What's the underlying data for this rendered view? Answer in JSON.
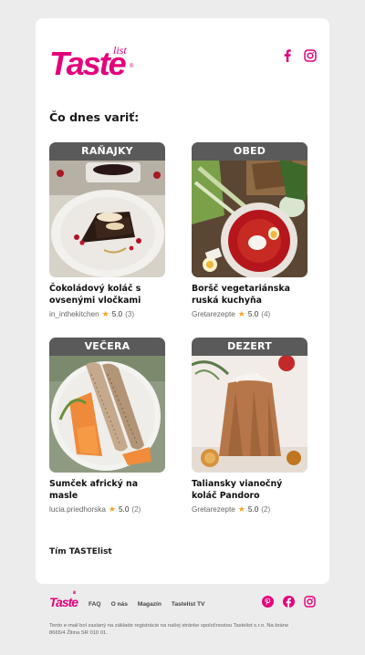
{
  "brand": {
    "logo_text": "Taste",
    "logo_sub": "list",
    "color": "#e4007c"
  },
  "social_top": [
    {
      "icon": "facebook-icon"
    },
    {
      "icon": "instagram-icon"
    }
  ],
  "heading": "Čo dnes variť:",
  "recipes": [
    {
      "category": "RAŇAJKY",
      "title": "Čokoládový koláč s ovsenými vločkami",
      "author": "in_inthekitchen",
      "rating": "5.0",
      "count": "(3)"
    },
    {
      "category": "OBED",
      "title": "Boršč vegetariánska ruská kuchyňa",
      "author": "Gretarezepte",
      "rating": "5.0",
      "count": "(4)"
    },
    {
      "category": "VEČERA",
      "title": "Sumček africký na masle",
      "author": "lucia.priedhorska",
      "rating": "5.0",
      "count": "(2)"
    },
    {
      "category": "DEZERT",
      "title": "Taliansky vianočný koláč Pandoro",
      "author": "Gretarezepte",
      "rating": "5.0",
      "count": "(2)"
    }
  ],
  "signoff": "Tím TASTElist",
  "footer": {
    "logo_text": "Taste",
    "logo_sub": "list",
    "nav": [
      "FAQ",
      "O nás",
      "Magazín",
      "Tastelist TV"
    ],
    "social": [
      {
        "icon": "pinterest-icon"
      },
      {
        "icon": "facebook-icon"
      },
      {
        "icon": "instagram-icon"
      }
    ],
    "legal": "Tento e-mail bol zaslaný na základe registrácie na našej stránke spoločnostou Tastelist s.r.o. Na bráne 8665/4 Žilina SR 010 01."
  }
}
